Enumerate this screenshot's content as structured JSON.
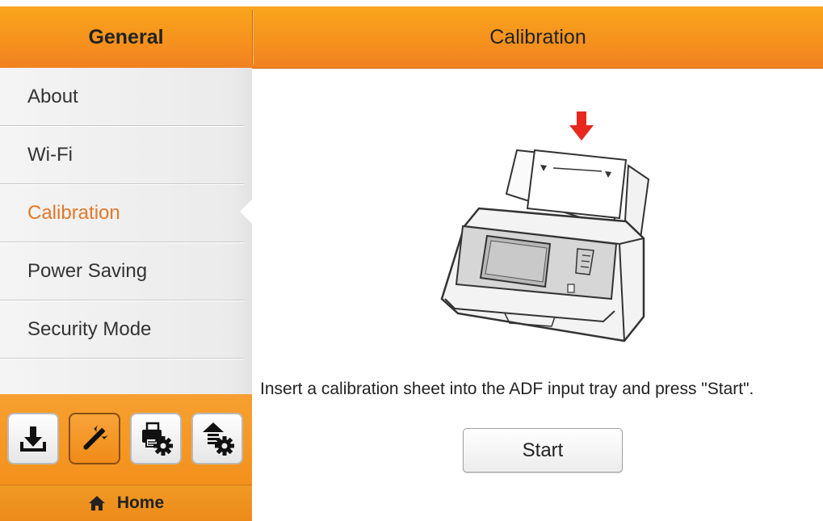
{
  "header": {
    "left_title": "General",
    "right_title": "Calibration"
  },
  "sidebar": {
    "items": [
      {
        "label": "About",
        "active": false
      },
      {
        "label": "Wi-Fi",
        "active": false
      },
      {
        "label": "Calibration",
        "active": true
      },
      {
        "label": "Power Saving",
        "active": false
      },
      {
        "label": "Security Mode",
        "active": false
      }
    ]
  },
  "toolbar": {
    "buttons": [
      {
        "icon": "download-icon",
        "active": false
      },
      {
        "icon": "wrench-icon",
        "active": true
      },
      {
        "icon": "printer-settings-icon",
        "active": false
      },
      {
        "icon": "upload-settings-icon",
        "active": false
      }
    ]
  },
  "home": {
    "icon": "home-icon",
    "label": "Home"
  },
  "main": {
    "illustration": "scanner-calibration-illustration",
    "instruction": "Insert a calibration sheet into the ADF input tray and press \"Start\".",
    "start_label": "Start"
  },
  "colors": {
    "header_orange": "#f6921e",
    "active_text": "#e0782a",
    "arrow_red": "#e8271f"
  }
}
